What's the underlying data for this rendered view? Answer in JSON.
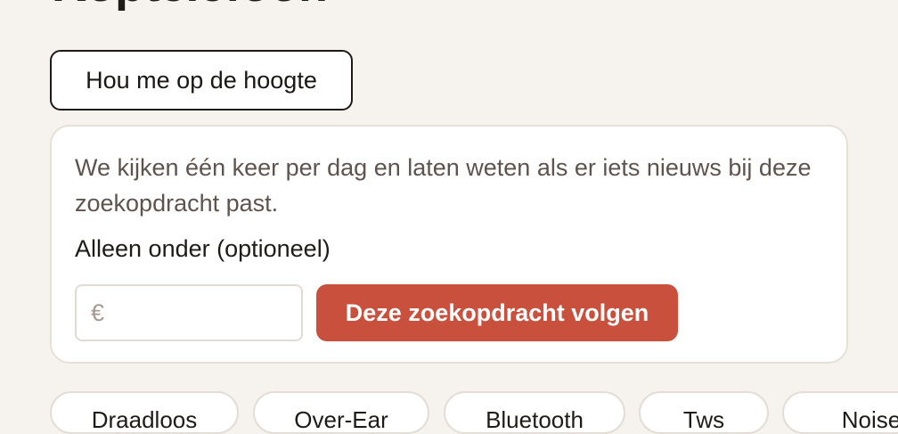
{
  "page": {
    "title": "Koptelefoon"
  },
  "follow_toggle": {
    "label": "Hou me op de hoogte"
  },
  "alert_card": {
    "description": "We kijken één keer per dag en laten weten als er iets nieuws bij deze zoekopdracht past.",
    "price_label": "Alleen onder (optioneel)",
    "price_input": {
      "currency_symbol": "€",
      "value": "",
      "placeholder": ""
    },
    "submit_label": "Deze zoekopdracht volgen"
  },
  "filter_chips": [
    {
      "label": "Draadloos"
    },
    {
      "label": "Over-Ear"
    },
    {
      "label": "Bluetooth"
    },
    {
      "label": "Tws"
    },
    {
      "label": "Noise"
    }
  ],
  "colors": {
    "background": "#f6f3ee",
    "accent": "#c8503d",
    "card_border": "#e6e0d8",
    "muted_text": "#5e544d"
  }
}
